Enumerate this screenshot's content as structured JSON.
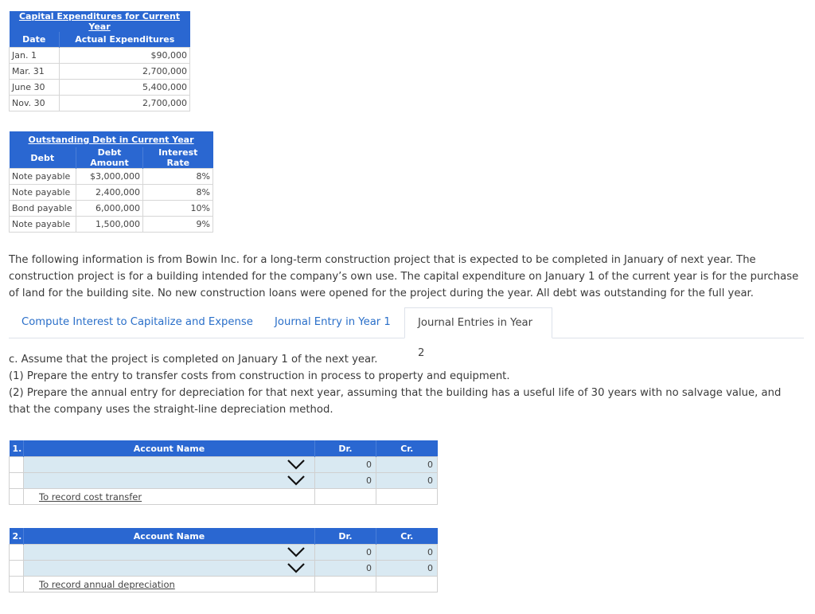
{
  "capital_expenditures": {
    "title": "Capital Expenditures for Current Year",
    "headers": [
      "Date",
      "Actual Expenditures"
    ],
    "rows": [
      {
        "date": "Jan. 1",
        "amount": "$90,000"
      },
      {
        "date": "Mar. 31",
        "amount": "2,700,000"
      },
      {
        "date": "June 30",
        "amount": "5,400,000"
      },
      {
        "date": "Nov. 30",
        "amount": "2,700,000"
      }
    ]
  },
  "outstanding_debt": {
    "title": "Outstanding Debt in Current Year",
    "headers": [
      "Debt",
      "Debt Amount",
      "Interest Rate"
    ],
    "rows": [
      {
        "debt": "Note payable",
        "amount": "$3,000,000",
        "rate": "8%"
      },
      {
        "debt": "Note payable",
        "amount": "2,400,000",
        "rate": "8%"
      },
      {
        "debt": "Bond payable",
        "amount": "6,000,000",
        "rate": "10%"
      },
      {
        "debt": "Note payable",
        "amount": "1,500,000",
        "rate": "9%"
      }
    ]
  },
  "intro_text": "The following information is from Bowin Inc. for a long-term construction project that is expected to be completed in January of next year. The construction project is for a building intended for the company’s own use. The capital expenditure on January 1 of the current year is for the purchase of land for the building site. No new construction loans were opened for the project during the year. All debt was outstanding for the full year.",
  "tabs": [
    {
      "label": "Compute Interest to Capitalize and Expense",
      "active": false
    },
    {
      "label": "Journal Entry in Year 1",
      "active": false
    },
    {
      "label": "Journal Entries in Year 2",
      "active": true
    }
  ],
  "instructions": [
    "c. Assume that the project is completed on January 1 of the next year.",
    "(1) Prepare the entry to transfer costs from construction in process to property and equipment.",
    "(2) Prepare the annual entry for depreciation for that next year, assuming that the building has a useful life of 30 years with no salvage value, and that the company uses the straight-line depreciation method."
  ],
  "journal_entries": [
    {
      "number": "1.",
      "headers": {
        "account": "Account Name",
        "dr": "Dr.",
        "cr": "Cr."
      },
      "rows": [
        {
          "account": "",
          "dr": "0",
          "cr": "0"
        },
        {
          "account": "",
          "dr": "0",
          "cr": "0"
        }
      ],
      "memo": "To record cost transfer"
    },
    {
      "number": "2.",
      "headers": {
        "account": "Account Name",
        "dr": "Dr.",
        "cr": "Cr."
      },
      "rows": [
        {
          "account": "",
          "dr": "0",
          "cr": "0"
        },
        {
          "account": "",
          "dr": "0",
          "cr": "0"
        }
      ],
      "memo": "To record annual depreciation"
    }
  ],
  "icons": {
    "dropdown": "chevron-down-icon"
  }
}
